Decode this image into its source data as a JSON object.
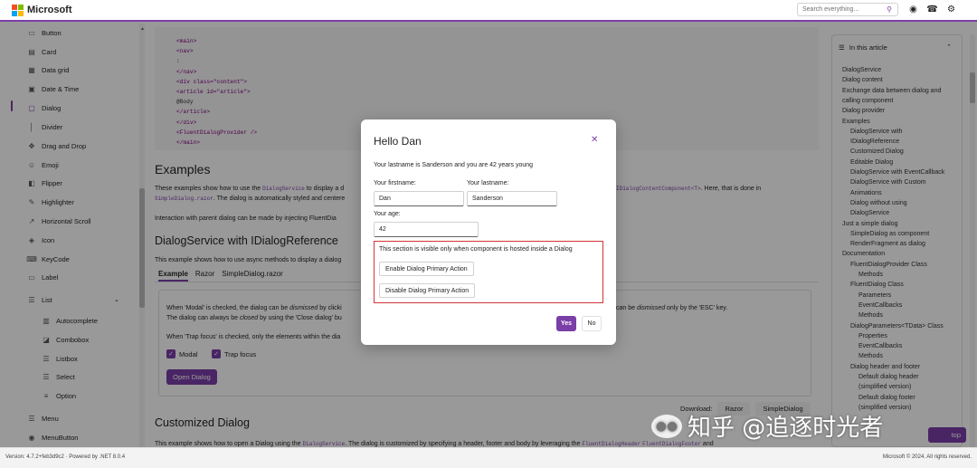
{
  "header": {
    "brand": "Microsoft",
    "search_placeholder": "Search everything...",
    "icons": [
      "github-icon",
      "bell-icon",
      "gear-icon"
    ]
  },
  "sidebar": {
    "items": [
      {
        "label": "Button",
        "icon": "button-icon"
      },
      {
        "label": "Card",
        "icon": "card-icon"
      },
      {
        "label": "Data grid",
        "icon": "grid-icon"
      },
      {
        "label": "Date & Time",
        "icon": "calendar-icon"
      },
      {
        "label": "Dialog",
        "icon": "dialog-icon",
        "active": true
      },
      {
        "label": "Divider",
        "icon": "divider-icon"
      },
      {
        "label": "Drag and Drop",
        "icon": "move-icon"
      },
      {
        "label": "Emoji",
        "icon": "emoji-icon"
      },
      {
        "label": "Flipper",
        "icon": "flipper-icon"
      },
      {
        "label": "Highlighter",
        "icon": "highlighter-icon"
      },
      {
        "label": "Horizontal Scroll",
        "icon": "scroll-icon"
      },
      {
        "label": "Icon",
        "icon": "icon-icon"
      },
      {
        "label": "KeyCode",
        "icon": "keyboard-icon"
      },
      {
        "label": "Label",
        "icon": "label-icon"
      },
      {
        "label": "List",
        "icon": "list-icon"
      }
    ],
    "list_children": [
      {
        "label": "Autocomplete",
        "icon": "autocomplete-icon"
      },
      {
        "label": "Combobox",
        "icon": "combobox-icon"
      },
      {
        "label": "Listbox",
        "icon": "listbox-icon"
      },
      {
        "label": "Select",
        "icon": "select-icon"
      },
      {
        "label": "Option",
        "icon": "option-icon"
      }
    ],
    "after": [
      {
        "label": "Menu",
        "icon": "menu-icon"
      },
      {
        "label": "MenuButton",
        "icon": "menubutton-icon"
      }
    ]
  },
  "code_lines": [
    "<main>",
    "<nav>",
    ":",
    "</nav>",
    "<div class=\"content\">",
    "<article id=\"article\">",
    "@Body",
    "</article>",
    "</div>",
    "<FluentDialogProvider />",
    "</main>"
  ],
  "main": {
    "examples_title": "Examples",
    "examples_p1_a": "These examples show how to use the ",
    "examples_p1_code": "DialogService",
    "examples_p1_b": " to display a d",
    "examples_p1_right_code": "IDialogContentComponent<T>",
    "examples_p1_right": ". Here, that is done in",
    "examples_p2_code": "SimpleDialog.razor",
    "examples_p2": ". The dialog is automatically styled and centere",
    "examples_p3": "Interaction with parent dialog can be made by injecting FluentDia",
    "section2_title": "DialogService with IDialogReference",
    "section2_p": "This example shows how to use async methods to display a dialog",
    "tabs": [
      "Example",
      "Razor",
      "SimpleDialog.razor"
    ],
    "demo_l1_a": "When 'Modal' is checked, the dialog can be ",
    "demo_l1_em": "dismissed",
    "demo_l1_b": " by clicki",
    "demo_l1_right_a": "can be ",
    "demo_l1_right_em": "dismissed",
    "demo_l1_right_b": " only by the 'ESC' key.",
    "demo_l2_a": "The dialog can always be ",
    "demo_l2_em": "closed",
    "demo_l2_b": " by using the 'Close dialog' bu",
    "demo_l3": "When 'Trap focus' is checked, only the elements within the dia",
    "modal_label": "Modal",
    "trap_label": "Trap focus",
    "open_button": "Open Dialog",
    "download_label": "Download:",
    "download_razor": "Razor",
    "download_simple": "SimpleDialog",
    "section3_title": "Customized Dialog",
    "section3_p_a": "This example shows how to open a Dialog using the ",
    "section3_p_code": "DialogService",
    "section3_p_b": ". The dialog is customized by specifying a header, footer and body by leveraging the ",
    "section3_p_code2": "FluentDialogHeader",
    "section3_p_code3": "FluentDialogFooter",
    "section3_p_c": " and"
  },
  "toc": {
    "title": "In this article",
    "items": [
      {
        "label": "DialogService",
        "indent": 0
      },
      {
        "label": "Dialog content",
        "indent": 0
      },
      {
        "label": "Exchange data between dialog and",
        "indent": 0
      },
      {
        "label": "calling component",
        "indent": 0
      },
      {
        "label": "Dialog provider",
        "indent": 0
      },
      {
        "label": "Examples",
        "indent": 0
      },
      {
        "label": "DialogService with",
        "indent": 1
      },
      {
        "label": "IDialogReference",
        "indent": 1
      },
      {
        "label": "Customized Dialog",
        "indent": 1
      },
      {
        "label": "Editable Dialog",
        "indent": 1
      },
      {
        "label": "DialogService with EventCallback",
        "indent": 1
      },
      {
        "label": "DialogService with Custom",
        "indent": 1
      },
      {
        "label": "Animations",
        "indent": 1
      },
      {
        "label": "Dialog without using",
        "indent": 1
      },
      {
        "label": "DialogService",
        "indent": 1
      },
      {
        "label": "Just a simple dialog",
        "indent": 0
      },
      {
        "label": "SimpleDialog as component",
        "indent": 1
      },
      {
        "label": "RenderFragment as dialog",
        "indent": 1
      },
      {
        "label": "Documentation",
        "indent": 0
      },
      {
        "label": "FluentDialogProvider Class",
        "indent": 1
      },
      {
        "label": "Methods",
        "indent": 2
      },
      {
        "label": "FluentDialog Class",
        "indent": 1
      },
      {
        "label": "Parameters",
        "indent": 2
      },
      {
        "label": "EventCallbacks",
        "indent": 2
      },
      {
        "label": "Methods",
        "indent": 2
      },
      {
        "label": "DialogParameters<TData> Class",
        "indent": 1
      },
      {
        "label": "Properties",
        "indent": 2
      },
      {
        "label": "EventCallbacks",
        "indent": 2
      },
      {
        "label": "Methods",
        "indent": 2
      },
      {
        "label": "Dialog header and footer",
        "indent": 1
      },
      {
        "label": "Default dialog header",
        "indent": 2
      },
      {
        "label": "(simplified version)",
        "indent": 2
      },
      {
        "label": "Default dialog footer",
        "indent": 2
      },
      {
        "label": "(simplified version)",
        "indent": 2
      }
    ]
  },
  "to_top": "top",
  "footer": {
    "version": "Version: 4.7.2+feb3d9c2  ·  Powered by .NET 8.0.4",
    "copyright": "Microsoft © 2024. All rights reserved."
  },
  "dialog": {
    "title": "Hello Dan",
    "message": "Your lastname is Sanderson and you are 42 years young",
    "firstname_label": "Your firstname:",
    "firstname_value": "Dan",
    "lastname_label": "Your lastname:",
    "lastname_value": "Sanderson",
    "age_label": "Your age:",
    "age_value": "42",
    "hosted_note": "This section is visible only when component is hosted inside a Dialog",
    "enable_button": "Enable Dialog Primary Action",
    "disable_button": "Disable Dialog Primary Action",
    "yes": "Yes",
    "no": "No"
  },
  "watermark": "知乎 @追逐时光者",
  "colors": {
    "accent": "#7b3fa8",
    "hosted_border": "#d13438"
  }
}
